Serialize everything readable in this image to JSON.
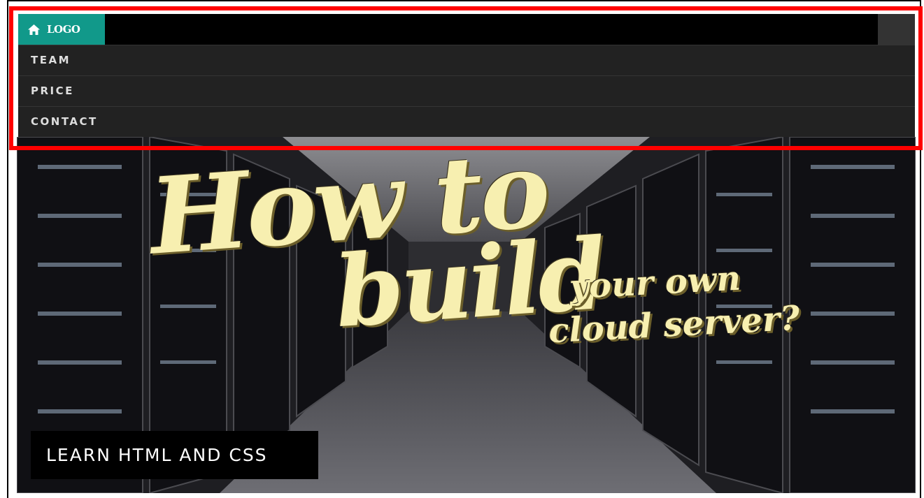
{
  "nav": {
    "logo_label": "LOGO",
    "logo_icon": "home-icon",
    "items": [
      {
        "label": "TEAM"
      },
      {
        "label": "PRICE"
      },
      {
        "label": "CONTACT"
      }
    ]
  },
  "hero": {
    "headline_line1": "How to",
    "headline_line2": "build",
    "headline_sub1": "your own",
    "headline_sub2": "cloud server?",
    "caption": "LEARN HTML AND CSS"
  },
  "colors": {
    "logo_bg": "#11998a",
    "nav_bg": "#222222",
    "highlight": "#ff0000",
    "headline": "#f7efb0"
  }
}
